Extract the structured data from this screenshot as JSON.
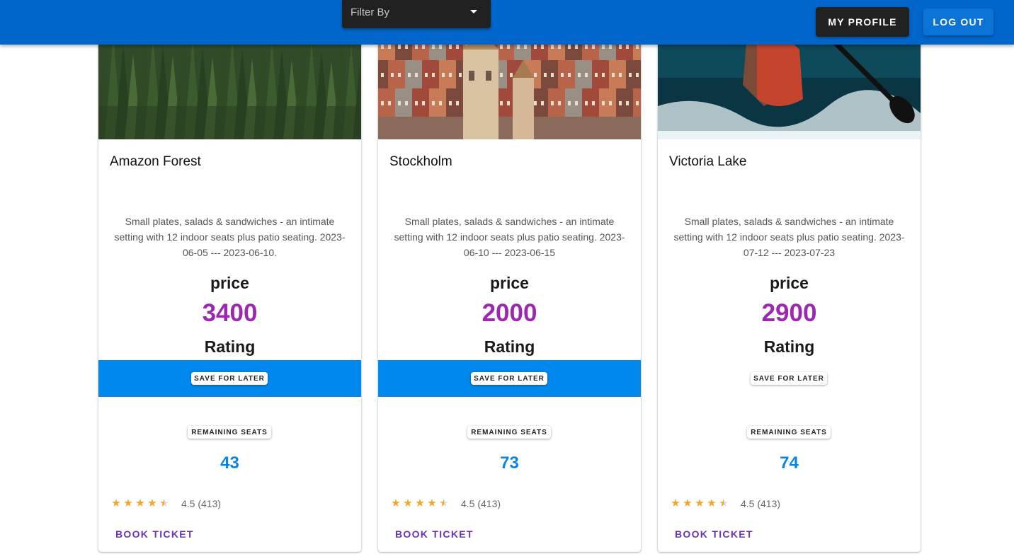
{
  "header": {
    "filter_label": "Filter By",
    "profile_label": "MY PROFILE",
    "logout_label": "LOG OUT"
  },
  "cards": [
    {
      "title": "Amazon Forest",
      "description": "Small plates, salads & sandwiches - an intimate setting with 12 indoor seats plus patio seating. 2023-06-05 --- 2023-06-10.",
      "price_label": "price",
      "price": "3400",
      "rating_label": "Rating",
      "save_label": "SAVE FOR LATER",
      "save_band_color": "#0088ee",
      "seats_label": "REMAINING SEATS",
      "seats": "43",
      "stars": 4.5,
      "rating_text": "4.5 (413)",
      "book_label": "BOOK TICKET",
      "image": "forest"
    },
    {
      "title": "Stockholm",
      "description": "Small plates, salads & sandwiches - an intimate setting with 12 indoor seats plus patio seating. 2023-06-10 --- 2023-06-15",
      "price_label": "price",
      "price": "2000",
      "rating_label": "Rating",
      "save_label": "SAVE FOR LATER",
      "save_band_color": "#0088ee",
      "seats_label": "REMAINING SEATS",
      "seats": "73",
      "stars": 4.5,
      "rating_text": "4.5 (413)",
      "book_label": "BOOK TICKET",
      "image": "city"
    },
    {
      "title": "Victoria Lake",
      "description": "Small plates, salads & sandwiches - an intimate setting with 12 indoor seats plus patio seating. 2023-07-12 --- 2023-07-23",
      "price_label": "price",
      "price": "2900",
      "rating_label": "Rating",
      "save_label": "SAVE FOR LATER",
      "save_band_color": "#ffffff",
      "seats_label": "REMAINING SEATS",
      "seats": "74",
      "stars": 4.5,
      "rating_text": "4.5 (413)",
      "book_label": "BOOK TICKET",
      "image": "lake"
    }
  ],
  "colors": {
    "appbar": "#0066cc",
    "price": "#9c27b0",
    "seats": "#0a84e0",
    "star": "#f5a623",
    "book": "#6a34b4"
  }
}
